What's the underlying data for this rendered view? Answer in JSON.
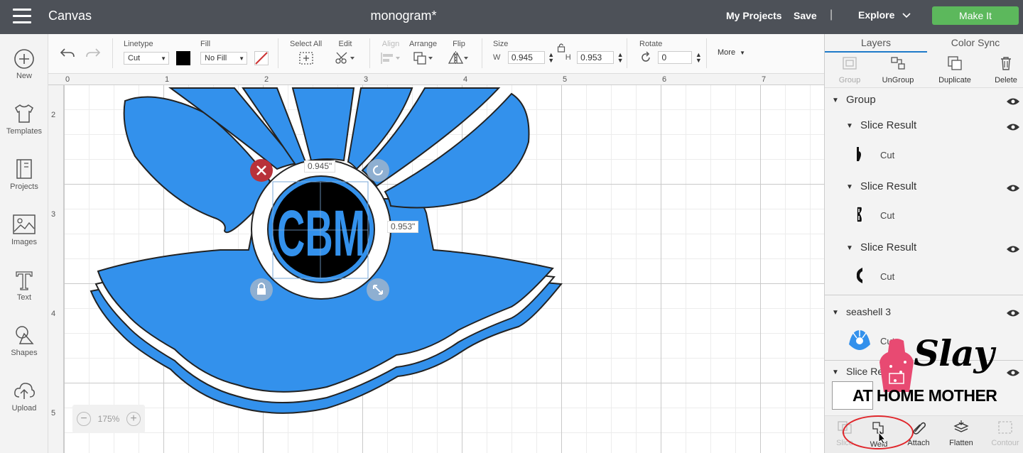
{
  "header": {
    "app_title": "Canvas",
    "project_title": "monogram*",
    "my_projects": "My Projects",
    "save": "Save",
    "separator": "|",
    "explore": "Explore",
    "make_it": "Make It",
    "make_it_color": "#5cb85c"
  },
  "sidebar": {
    "items": [
      {
        "label": "New",
        "icon": "plus-circle-icon"
      },
      {
        "label": "Templates",
        "icon": "shirt-icon"
      },
      {
        "label": "Projects",
        "icon": "projects-icon"
      },
      {
        "label": "Images",
        "icon": "image-icon"
      },
      {
        "label": "Text",
        "icon": "text-icon"
      },
      {
        "label": "Shapes",
        "icon": "shapes-icon"
      },
      {
        "label": "Upload",
        "icon": "upload-icon"
      }
    ]
  },
  "toolbar": {
    "linetype_label": "Linetype",
    "linetype_value": "Cut",
    "fill_label": "Fill",
    "fill_value": "No Fill",
    "select_all_label": "Select All",
    "edit_label": "Edit",
    "align_label": "Align",
    "arrange_label": "Arrange",
    "flip_label": "Flip",
    "size_label": "Size",
    "w_label": "W",
    "w_value": "0.945",
    "h_label": "H",
    "h_value": "0.953",
    "rotate_label": "Rotate",
    "rotate_value": "0",
    "more_label": "More",
    "line_color": "#000000"
  },
  "rulers": {
    "top": [
      "0",
      "1",
      "2",
      "3",
      "4",
      "5",
      "6",
      "7"
    ],
    "left": [
      "2",
      "3",
      "4",
      "5"
    ]
  },
  "canvas": {
    "zoom_level": "175%",
    "width_label": "0.945\"",
    "height_label": "0.953\"",
    "monogram_text": "CBM",
    "shell_color": "#3391ec"
  },
  "right_panel": {
    "tabs": [
      "Layers",
      "Color Sync"
    ],
    "actions": [
      {
        "label": "Group",
        "enabled": false
      },
      {
        "label": "UnGroup",
        "enabled": true
      },
      {
        "label": "Duplicate",
        "enabled": true
      },
      {
        "label": "Delete",
        "enabled": true
      }
    ],
    "layers": {
      "group_name": "Group",
      "children": [
        {
          "name": "Slice Result",
          "linetype": "Cut"
        },
        {
          "name": "Slice Result",
          "linetype": "Cut"
        },
        {
          "name": "Slice Result",
          "linetype": "Cut"
        }
      ],
      "seashell_name": "seashell 3",
      "seashell_linetype": "Cut",
      "slice_partial": "Slice Re"
    },
    "bottom_actions": [
      {
        "label": "Slice",
        "enabled": false
      },
      {
        "label": "Weld",
        "enabled": true
      },
      {
        "label": "Attach",
        "enabled": true
      },
      {
        "label": "Flatten",
        "enabled": true
      },
      {
        "label": "Contour",
        "enabled": false
      }
    ]
  },
  "watermark": {
    "line1": "Slay",
    "line2": "AT HOME MOTHER"
  }
}
